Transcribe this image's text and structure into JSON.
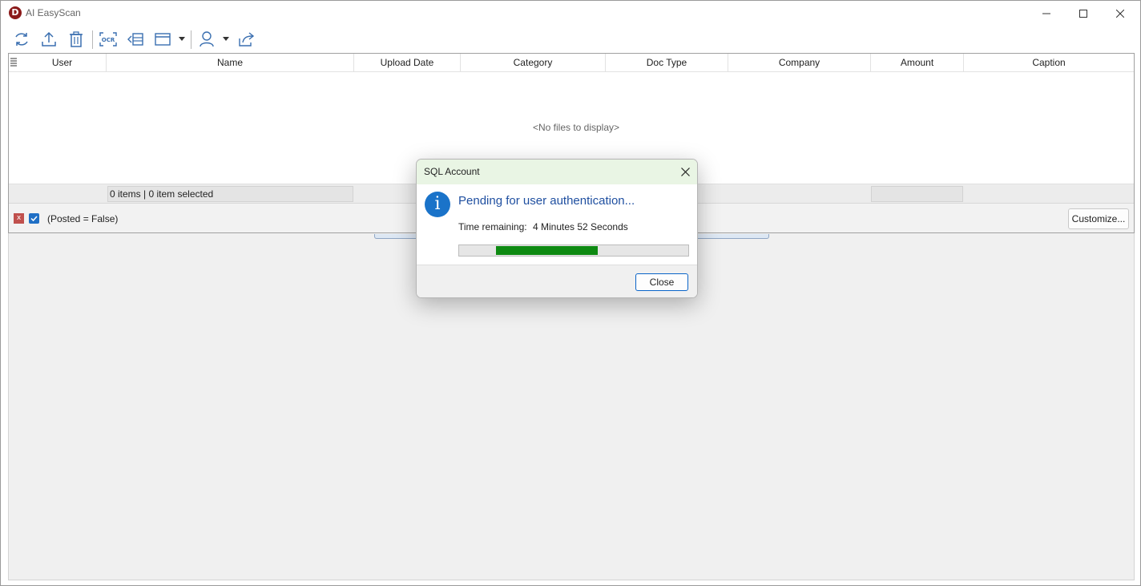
{
  "window": {
    "title": "AI EasyScan",
    "logo_letter": "D"
  },
  "toolbar": {
    "buttons": [
      {
        "name": "refresh-icon"
      },
      {
        "name": "upload-icon"
      },
      {
        "name": "delete-icon"
      },
      {
        "name": "ocr-icon",
        "label": "OCR"
      },
      {
        "name": "move-to-list-icon"
      },
      {
        "name": "layout-icon"
      },
      {
        "name": "user-icon"
      },
      {
        "name": "share-icon"
      }
    ],
    "accent_color": "#3a6fb0"
  },
  "grid": {
    "columns": [
      "User",
      "Name",
      "Upload Date",
      "Category",
      "Doc Type",
      "Company",
      "Amount",
      "Caption"
    ],
    "empty_message": "<No files to display>",
    "footer_count": "0 items |  0 item selected",
    "filter_text": "(Posted = False)",
    "filter_clear_glyph": "x",
    "customize_label": "Customize..."
  },
  "dialog": {
    "title": "SQL Account",
    "icon": "info-icon",
    "icon_glyph": "i",
    "heading": "Pending for user authentication...",
    "time_label": "Time remaining:",
    "time_value": "4 Minutes 52 Seconds",
    "progress": {
      "start_fraction": 0.16,
      "end_fraction": 0.605
    },
    "progress_color": "#0e8a12",
    "close_label": "Close"
  }
}
